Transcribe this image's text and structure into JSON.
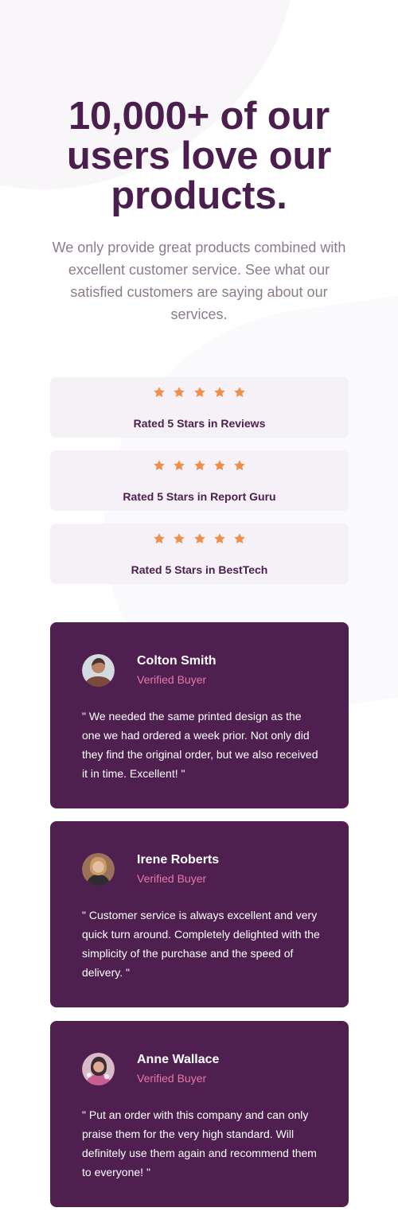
{
  "hero": {
    "title": "10,000+ of our users love our products.",
    "subtitle": "We only provide great products combined with excellent customer service. See what our satisfied customers are saying about our services."
  },
  "ratings": [
    {
      "stars": 5,
      "label": "Rated 5 Stars in Reviews"
    },
    {
      "stars": 5,
      "label": "Rated 5 Stars in Report Guru"
    },
    {
      "stars": 5,
      "label": "Rated 5 Stars in BestTech"
    }
  ],
  "testimonials": [
    {
      "name": "Colton Smith",
      "role": "Verified Buyer",
      "quote": "\" We needed the same printed design as the one we had ordered a week prior. Not only did they find the original order, but we also received it in time. Excellent! \""
    },
    {
      "name": "Irene Roberts",
      "role": "Verified Buyer",
      "quote": "\" Customer service is always excellent and very quick turn around. Completely delighted with the simplicity of the purchase and the speed of delivery. \""
    },
    {
      "name": "Anne Wallace",
      "role": "Verified Buyer",
      "quote": "\" Put an order with this company and can only praise them for the very high standard. Will definitely use them again and recommend them to everyone! \""
    }
  ],
  "colors": {
    "primary": "#4b1f4d",
    "card_bg": "#f6f0f7",
    "testimonial_bg": "#4f1f4f",
    "star": "#ef8f4c",
    "accent_pink": "#e879a8",
    "muted": "#8c7b8d"
  },
  "icons": {
    "star": "star-icon",
    "avatar": "avatar"
  }
}
